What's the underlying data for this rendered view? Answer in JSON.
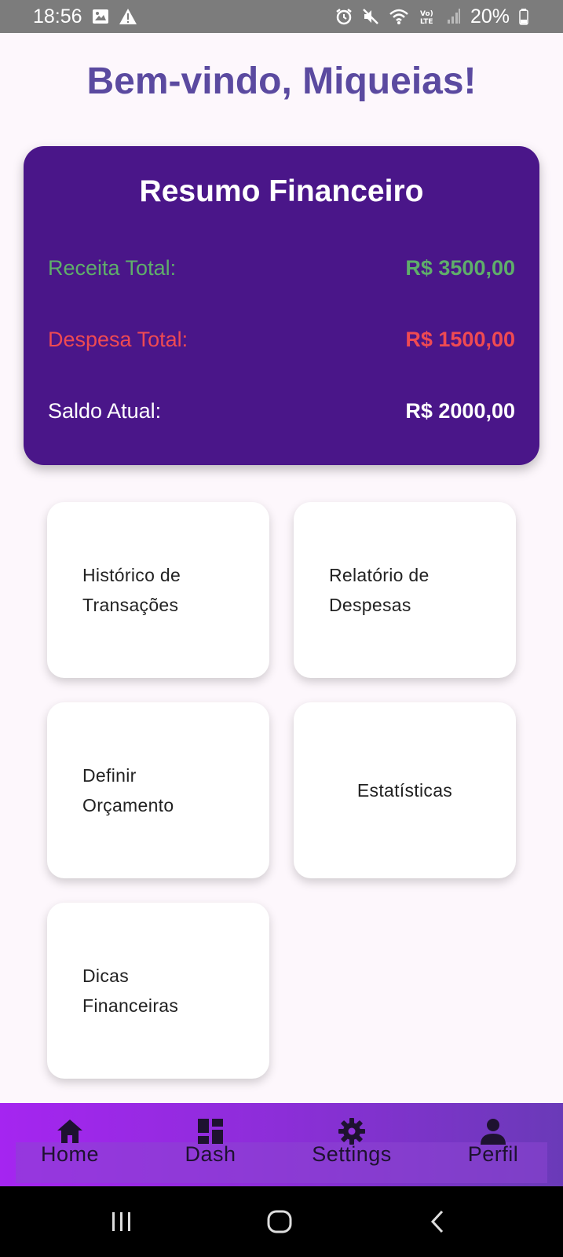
{
  "status_bar": {
    "time": "18:56",
    "battery": "20%",
    "left_icons": [
      "image-icon",
      "warning-icon"
    ],
    "right_icons": [
      "alarm-icon",
      "mute-icon",
      "wifi-icon",
      "volte-icon",
      "signal-icon",
      "battery-icon"
    ],
    "volte_text": "Vo) LTE"
  },
  "welcome": "Bem-vindo, Miqueias!",
  "summary": {
    "title": "Resumo Financeiro",
    "income": {
      "label": "Receita Total:",
      "value": "R$ 3500,00"
    },
    "expense": {
      "label": "Despesa Total:",
      "value": "R$ 1500,00"
    },
    "balance": {
      "label": "Saldo Atual:",
      "value": "R$ 2000,00"
    }
  },
  "menu": [
    {
      "line1": "Histórico de",
      "line2": "Transações"
    },
    {
      "line1": "Relatório de",
      "line2": "Despesas"
    },
    {
      "line1": "Definir",
      "line2": "Orçamento"
    },
    {
      "line1": "Estatísticas",
      "line2": ""
    },
    {
      "line1": "Dicas",
      "line2": "Financeiras"
    }
  ],
  "bottom_nav": [
    {
      "label": "Home",
      "icon": "home-icon"
    },
    {
      "label": "Dash",
      "icon": "dashboard-icon"
    },
    {
      "label": "Settings",
      "icon": "gear-icon"
    },
    {
      "label": "Perfil",
      "icon": "person-icon"
    }
  ],
  "colors": {
    "accent_text": "#5b4aa0",
    "card_bg": "#4a1689",
    "income": "#5fae6a",
    "expense": "#ef4a52",
    "nav_gradient_start": "#a525f0",
    "nav_gradient_end": "#6a3ab8"
  }
}
